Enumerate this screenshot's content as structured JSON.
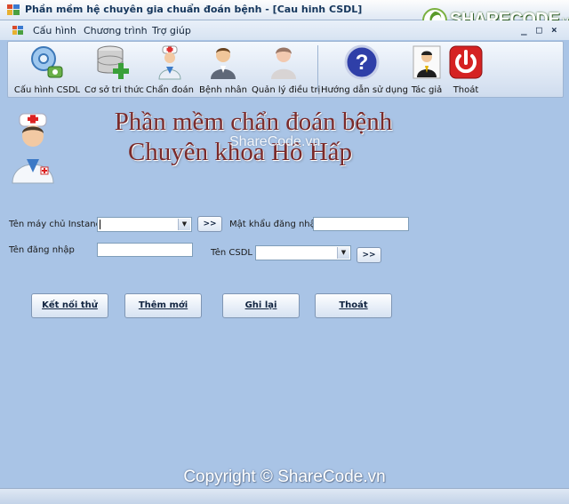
{
  "window": {
    "title": "Phần mềm hệ chuyên gia chuẩn đoán bệnh - [Cau hinh CSDL]",
    "controls": [
      "_",
      "□",
      "×"
    ]
  },
  "brand": {
    "name": "SHARECODE",
    "suffix": ".vn"
  },
  "menu": [
    {
      "label": "Cấu hình"
    },
    {
      "label": "Chương trình"
    },
    {
      "label": "Trợ giúp"
    }
  ],
  "toolbar": [
    {
      "label": "Cấu hình CSDL",
      "icon": "database-config-icon"
    },
    {
      "label": "Cơ sở tri thức",
      "icon": "database-add-icon"
    },
    {
      "label": "Chẩn đoán",
      "icon": "doctor-icon"
    },
    {
      "label": "Bệnh nhân",
      "icon": "patient-icon"
    },
    {
      "label": "Quản lý điều trị",
      "icon": "nurse-icon"
    },
    {
      "label": "Hướng dẫn sử dụng",
      "icon": "help-icon"
    },
    {
      "label": "Tác giả",
      "icon": "author-icon"
    },
    {
      "label": "Thoát",
      "icon": "power-icon"
    }
  ],
  "heading": {
    "line1": "Phần mềm chẩn đoán bệnh",
    "line2": "Chuyên khoa Hô Hấp",
    "watermark": "ShareCode.vn"
  },
  "form": {
    "server_label": "Tên máy chủ Instance",
    "server_value": "",
    "browse_server": ">>",
    "password_label": "Mật khẩu đăng nhập",
    "password_value": "",
    "username_label": "Tên đăng nhập",
    "username_value": "",
    "db_label": "Tên CSDL",
    "db_value": "",
    "browse_db": ">>"
  },
  "buttons": [
    {
      "label": "Kết nối thử"
    },
    {
      "label": "Thêm mới"
    },
    {
      "label": "Ghi lại"
    },
    {
      "label": "Thoát"
    }
  ],
  "footer": {
    "copyright": "Copyright © ShareCode.vn"
  },
  "colors": {
    "background": "#a9c4e6",
    "heading": "#7a2a2a",
    "brand_green": "#5a9a2a"
  }
}
